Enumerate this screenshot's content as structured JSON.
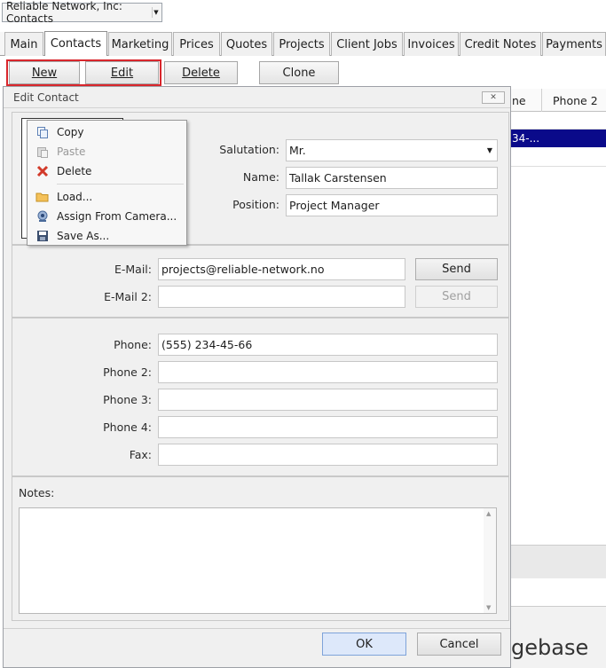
{
  "window": {
    "title": "Reliable Network, Inc: Contacts"
  },
  "tabs": [
    "Main",
    "Contacts",
    "Marketing",
    "Prices",
    "Quotes",
    "Projects",
    "Client Jobs",
    "Invoices",
    "Credit Notes",
    "Payments"
  ],
  "toolbar": {
    "new": "New",
    "edit": "Edit",
    "delete": "Delete",
    "clone": "Clone"
  },
  "grid": {
    "col_phone_suffix": "ne",
    "col_phone2": "Phone 2",
    "selected_phone": "34-..."
  },
  "watermark_text": "gebase",
  "dialog": {
    "title": "Edit Contact",
    "close": "✕",
    "salutation_label": "Salutation:",
    "salutation_value": "Mr.",
    "name_label": "Name:",
    "name_value": "Tallak Carstensen",
    "position_label": "Position:",
    "position_value": "Project Manager",
    "email_label": "E-Mail:",
    "email_value": "projects@reliable-network.no",
    "email2_label": "E-Mail 2:",
    "email2_value": "",
    "send": "Send",
    "send2": "Send",
    "phone_label": "Phone:",
    "phone_value": "(555) 234-45-66",
    "phone2_label": "Phone 2:",
    "phone3_label": "Phone 3:",
    "phone4_label": "Phone 4:",
    "fax_label": "Fax:",
    "notes_label": "Notes:",
    "ok": "OK",
    "cancel": "Cancel"
  },
  "context_menu": {
    "copy": "Copy",
    "paste": "Paste",
    "delete": "Delete",
    "load": "Load...",
    "camera": "Assign From Camera...",
    "save_as": "Save As..."
  },
  "colors": {
    "highlight": "#d9262c",
    "selection": "#0a0a8a",
    "ok_button": "#dde8fa"
  }
}
